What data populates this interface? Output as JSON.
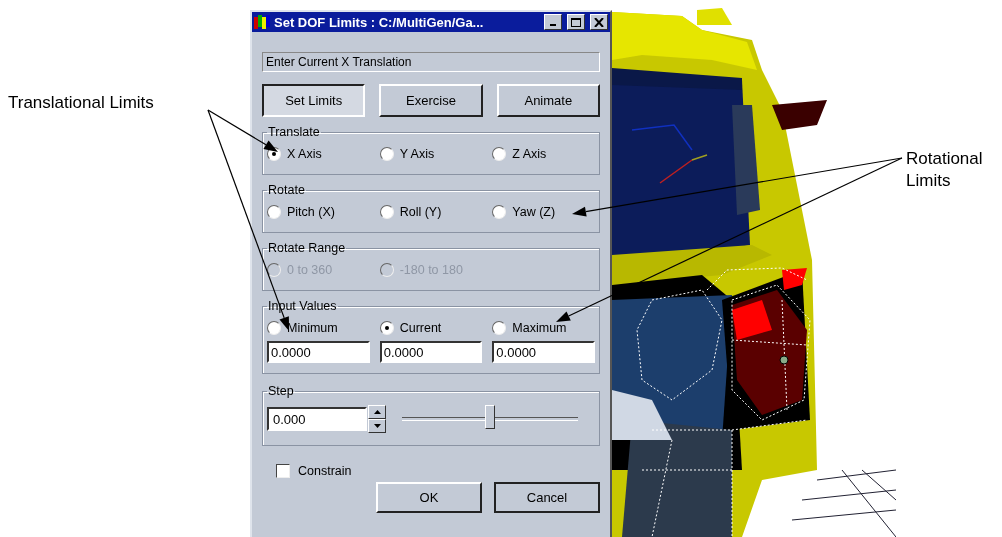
{
  "window": {
    "title": "Set DOF Limits : C:/MultiGen/Ga..."
  },
  "prompt": "Enter Current X Translation",
  "mode_buttons": [
    {
      "label": "Set Limits",
      "selected": true
    },
    {
      "label": "Exercise",
      "selected": false
    },
    {
      "label": "Animate",
      "selected": false
    }
  ],
  "groups": [
    {
      "title": "Translate",
      "disabled": false,
      "options": [
        {
          "label": "X Axis",
          "selected": true
        },
        {
          "label": "Y Axis",
          "selected": false
        },
        {
          "label": "Z Axis",
          "selected": false
        }
      ]
    },
    {
      "title": "Rotate",
      "disabled": false,
      "options": [
        {
          "label": "Pitch (X)",
          "selected": false
        },
        {
          "label": "Roll (Y)",
          "selected": false
        },
        {
          "label": "Yaw (Z)",
          "selected": false
        }
      ]
    },
    {
      "title": "Rotate Range",
      "disabled": true,
      "options": [
        {
          "label": "0 to 360",
          "selected": false
        },
        {
          "label": "-180 to 180",
          "selected": false
        }
      ]
    }
  ],
  "input_values": {
    "title": "Input Values",
    "options": [
      {
        "label": "Minimum",
        "selected": false,
        "value": "0.0000"
      },
      {
        "label": "Current",
        "selected": true,
        "value": "0.0000"
      },
      {
        "label": "Maximum",
        "selected": false,
        "value": "0.0000"
      }
    ]
  },
  "step": {
    "title": "Step",
    "value": "0.000",
    "level": 0.5
  },
  "constrain": {
    "label": "Constrain",
    "checked": false
  },
  "buttons": [
    "OK",
    "Cancel"
  ],
  "annotations": [
    {
      "lines": [
        "Translational Limits"
      ]
    },
    {
      "lines": [
        "Rotational",
        "Limits"
      ]
    }
  ]
}
